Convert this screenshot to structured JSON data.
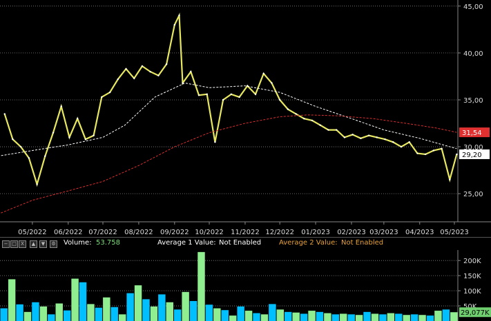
{
  "chart_data": [
    {
      "type": "line",
      "y_ticks": [
        "45,00",
        "40,00",
        "35,00",
        "30,00",
        "25,00"
      ],
      "x_ticks": [
        "05/2022",
        "06/2022",
        "07/2022",
        "08/2022",
        "09/2022",
        "10/2022",
        "11/2022",
        "12/2022",
        "01/2023",
        "02/2023",
        "03/2023",
        "04/2023",
        "05/2023"
      ],
      "ylim": [
        22,
        45.5
      ],
      "price_axis_badges": [
        {
          "label": "31,54",
          "value": 31.54,
          "color": "#e03030"
        },
        {
          "label": "29,20",
          "value": 29.2,
          "color": "#ffffff"
        }
      ],
      "series": [
        {
          "color": "#e8e860",
          "dates": [
            "2022-04-07",
            "2022-04-14",
            "2022-04-21",
            "2022-04-28",
            "2022-05-05",
            "2022-05-12",
            "2022-05-19",
            "2022-05-26",
            "2022-06-02",
            "2022-06-09",
            "2022-06-16",
            "2022-06-23",
            "2022-06-30",
            "2022-07-07",
            "2022-07-14",
            "2022-07-21",
            "2022-07-28",
            "2022-08-04",
            "2022-08-11",
            "2022-08-18",
            "2022-08-25",
            "2022-09-01",
            "2022-09-05",
            "2022-09-08",
            "2022-09-15",
            "2022-09-22",
            "2022-09-29",
            "2022-10-06",
            "2022-10-13",
            "2022-10-20",
            "2022-10-27",
            "2022-11-03",
            "2022-11-10",
            "2022-11-17",
            "2022-11-24",
            "2022-12-01",
            "2022-12-08",
            "2022-12-15",
            "2022-12-22",
            "2022-12-29",
            "2023-01-05",
            "2023-01-12",
            "2023-01-19",
            "2023-01-26",
            "2023-02-02",
            "2023-02-09",
            "2023-02-16",
            "2023-02-23",
            "2023-03-02",
            "2023-03-09",
            "2023-03-16",
            "2023-03-23",
            "2023-03-30",
            "2023-04-06",
            "2023-04-13",
            "2023-04-20",
            "2023-04-27",
            "2023-05-03"
          ],
          "values": [
            33.5,
            30.8,
            30.0,
            28.8,
            26.0,
            29.0,
            31.5,
            34.3,
            31.0,
            33.0,
            30.8,
            31.2,
            35.3,
            35.8,
            37.2,
            38.3,
            37.3,
            38.6,
            38.0,
            37.6,
            38.8,
            43.0,
            44.0,
            36.8,
            38.0,
            35.5,
            35.6,
            30.5,
            35.0,
            35.6,
            35.3,
            36.5,
            35.6,
            37.8,
            36.8,
            35.0,
            34.0,
            33.5,
            33.0,
            32.8,
            32.3,
            31.8,
            31.8,
            31.0,
            31.3,
            30.9,
            31.2,
            31.0,
            30.8,
            30.5,
            30.0,
            30.5,
            29.3,
            29.2,
            29.6,
            29.8,
            26.5,
            29.2
          ]
        },
        {
          "line_style": "dashed",
          "color": "#ffffff",
          "dates": [
            "2022-04-01",
            "2022-05-01",
            "2022-06-01",
            "2022-07-01",
            "2022-07-20",
            "2022-08-15",
            "2022-09-10",
            "2022-10-01",
            "2022-11-01",
            "2022-12-01",
            "2023-01-01",
            "2023-02-01",
            "2023-03-01",
            "2023-04-01",
            "2023-05-03"
          ],
          "values": [
            29.0,
            29.6,
            30.2,
            31.0,
            32.3,
            35.3,
            36.8,
            36.3,
            36.5,
            35.8,
            34.3,
            33.0,
            31.8,
            30.9,
            29.8
          ]
        },
        {
          "line_style": "dashed",
          "color": "#e03030",
          "dates": [
            "2022-04-01",
            "2022-05-01",
            "2022-06-01",
            "2022-07-01",
            "2022-08-01",
            "2022-09-01",
            "2022-10-01",
            "2022-11-01",
            "2022-12-01",
            "2022-12-25",
            "2023-01-20",
            "2023-02-20",
            "2023-03-20",
            "2023-04-15",
            "2023-05-03"
          ],
          "values": [
            22.8,
            24.3,
            25.3,
            26.3,
            28.0,
            30.0,
            31.5,
            32.5,
            33.2,
            33.4,
            33.3,
            33.0,
            32.5,
            32.0,
            31.54
          ]
        }
      ]
    },
    {
      "type": "bar",
      "y_ticks": [
        "200K",
        "150K",
        "100K",
        "50K"
      ],
      "ylim": [
        0,
        230000
      ],
      "last_value_badge": {
        "label": "29,077K",
        "value": 29077
      },
      "bar_colors": [
        "#00bfff",
        "#90ee90"
      ],
      "volume_values": [
        42000,
        138000,
        55000,
        30000,
        62000,
        48000,
        22000,
        58000,
        35000,
        140000,
        128000,
        56000,
        44000,
        78000,
        46000,
        22000,
        92000,
        118000,
        72000,
        48000,
        88000,
        62000,
        38000,
        96000,
        66000,
        228000,
        54000,
        42000,
        36000,
        18000,
        48000,
        34000,
        26000,
        22000,
        56000,
        38000,
        30000,
        28000,
        24000,
        34000,
        30000,
        26000,
        22000,
        24000,
        22000,
        20000,
        30000,
        24000,
        22000,
        26000,
        24000,
        20000,
        22000,
        20000,
        18000,
        34000,
        38000,
        29077
      ]
    }
  ],
  "volume_toolbar": {
    "buttons": [
      "−",
      "□",
      "X",
      "▲",
      "▼",
      "gear"
    ],
    "volume_label": "Volume:",
    "volume_value": "53.758",
    "avg1_label": "Average 1 Value:",
    "avg1_value": "Not Enabled",
    "avg2_label": "Average 2 Value:",
    "avg2_value": "Not Enabled",
    "colors": {
      "volume_value": "#7ddf7d",
      "avg2": "#e8a23a",
      "label": "#ffffff"
    }
  }
}
